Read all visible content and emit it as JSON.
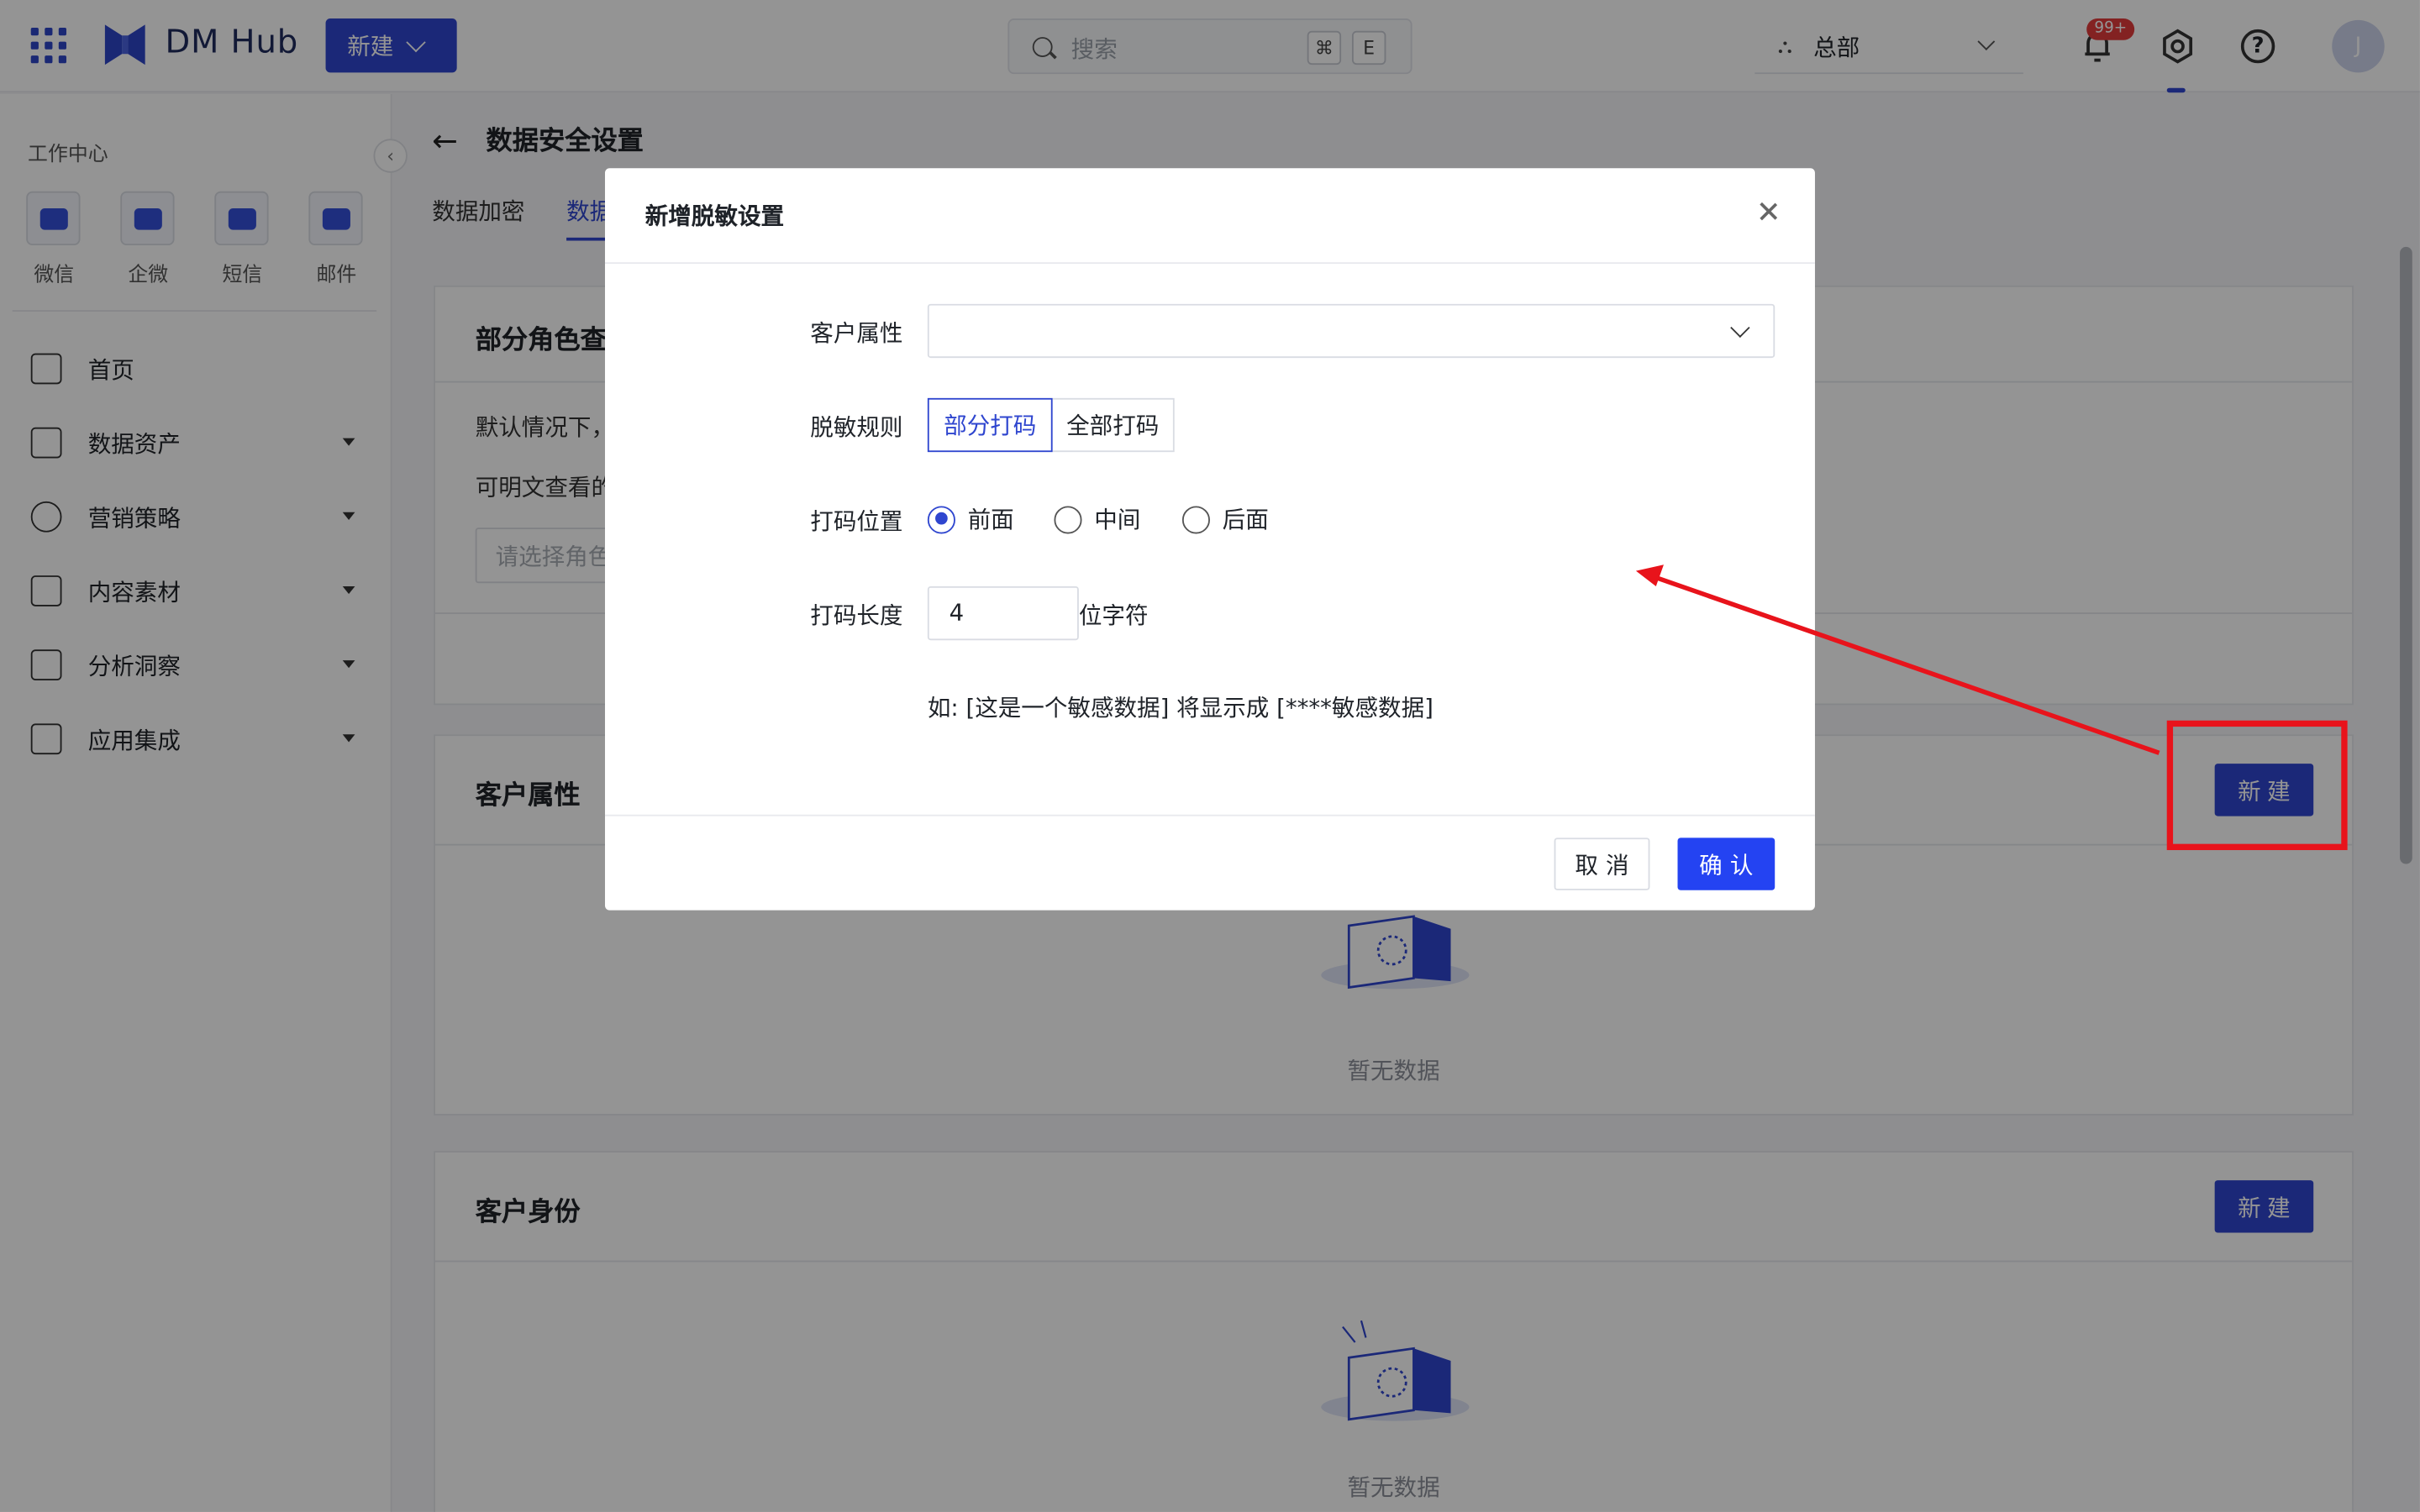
{
  "header": {
    "logo_text": "DM Hub",
    "new_label": "新建",
    "search_placeholder": "搜索",
    "kbd_cmd": "⌘",
    "kbd_e": "E",
    "org_label": "总部",
    "notif_badge": "99+",
    "avatar_initial": "J"
  },
  "sidebar": {
    "title": "工作中心",
    "channels": [
      "微信",
      "企微",
      "短信",
      "邮件"
    ],
    "nav": [
      "首页",
      "数据资产",
      "营销策略",
      "内容素材",
      "分析洞察",
      "应用集成"
    ]
  },
  "main": {
    "page_title": "数据安全设置",
    "tabs": [
      "数据加密",
      "数据"
    ],
    "card1": {
      "title": "部分角色查",
      "line1": "默认情况下，",
      "line2": "可明文查看的",
      "role_placeholder": "请选择角色"
    },
    "card2": {
      "title": "客户属性",
      "new_label": "新建",
      "empty_text": "暂无数据"
    },
    "card3": {
      "title": "客户身份",
      "new_label": "新建",
      "empty_text": "暂无数据"
    }
  },
  "modal": {
    "title": "新增脱敏设置",
    "fields": {
      "attribute_label": "客户属性",
      "attribute_value": "",
      "rule_label": "脱敏规则",
      "rule_options": [
        "部分打码",
        "全部打码"
      ],
      "rule_selected": "部分打码",
      "position_label": "打码位置",
      "position_options": [
        "前面",
        "中间",
        "后面"
      ],
      "position_selected": "前面",
      "length_label": "打码长度",
      "length_value": "4",
      "length_suffix": "位字符",
      "example": "如: [这是一个敏感数据] 将显示成 [****敏感数据]"
    },
    "cancel_label": "取消",
    "ok_label": "确认"
  },
  "colors": {
    "primary": "#2f46cf",
    "confirm": "#2443f2",
    "annotation_red": "#e8131b",
    "badge_red": "#e23b3b"
  }
}
